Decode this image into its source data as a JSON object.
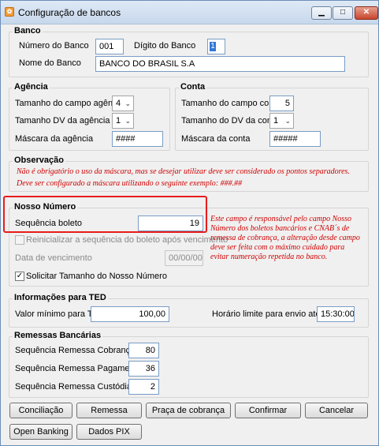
{
  "window": {
    "title": "Configuração de bancos"
  },
  "banco": {
    "title": "Banco",
    "numero_label": "Número do Banco",
    "numero_value": "001",
    "digito_label": "Dígito do Banco",
    "digito_value": "1",
    "nome_label": "Nome do Banco",
    "nome_value": "BANCO DO BRASIL S.A"
  },
  "agencia": {
    "title": "Agência",
    "tamanho_label": "Tamanho do campo agência",
    "tamanho_value": "4",
    "dv_label": "Tamanho DV da agência",
    "dv_value": "1",
    "mascara_label": "Máscara da agência",
    "mascara_value": "####"
  },
  "conta": {
    "title": "Conta",
    "tamanho_label": "Tamanho do campo conta",
    "tamanho_value": "5",
    "dv_label": "Tamanho do DV da conta",
    "dv_value": "1",
    "mascara_label": "Máscara da conta",
    "mascara_value": "#####"
  },
  "observacao": {
    "title": "Observação",
    "line1": "Não é obrigatório o uso da máscara, mas se desejar utilizar deve ser considerado os pontos separadores.",
    "line2": "Deve ser configurado a máscara utilizando o seguinte exemplo: ###.##"
  },
  "nosso_numero": {
    "title": "Nosso Número",
    "sequencia_label": "Sequência boleto",
    "sequencia_value": "19",
    "reinicializar_label": "Reinicializar a sequência do boleto após vencimento",
    "data_label": "Data de vencimento",
    "data_value": "00/00/00",
    "solicitar_label": "Solicitar Tamanho do Nosso Número",
    "solicitar_checked": "✓",
    "note_lines": [
      "Este campo é responsável pelo campo Nosso",
      "Número dos boletos bancários e CNAB´s de",
      "remessa de cobrança, a alteração desde campo",
      "deve ser feita com o máximo cuidado para",
      "evitar numeração repetida no banco."
    ]
  },
  "ted": {
    "title": "Informações para TED",
    "valor_label": "Valor mínimo para TED",
    "valor_value": "100,00",
    "horario_label": "Horário limite para envio até às",
    "horario_value": "15:30:00"
  },
  "remessas": {
    "title": "Remessas Bancárias",
    "cobranca_label": "Sequência Remessa Cobrança",
    "cobranca_value": "80",
    "pagamento_label": "Sequência Remessa Pagamento",
    "pagamento_value": "36",
    "custodia_label": "Sequência Remessa Custódia",
    "custodia_value": "2"
  },
  "buttons": {
    "conciliacao": "Conciliação",
    "remessa": "Remessa",
    "praca": "Praça de cobrança",
    "confirmar": "Confirmar",
    "cancelar": "Cancelar",
    "open_banking": "Open Banking",
    "dados_pix": "Dados PIX"
  },
  "colors": {
    "note": "#d00000",
    "highlight": "#e81c1c",
    "selection": "#3277d8"
  }
}
